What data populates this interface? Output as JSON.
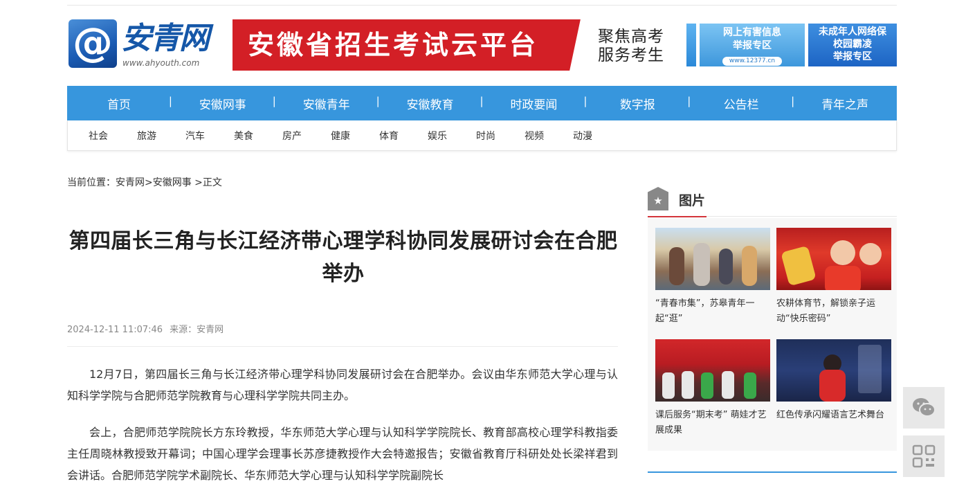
{
  "header": {
    "logo_mark": "@",
    "logo_text": "安青网",
    "logo_url": "www.ahyouth.com",
    "banner_title": "安徽省招生考试云平台",
    "banner_side_line1": "聚焦高考",
    "banner_side_line2": "服务考生",
    "ad_left_line1": "网上有害信息",
    "ad_left_line2": "举报专区",
    "ad_left_url": "www.12377.cn",
    "ad_right_line1": "未成年人网络保",
    "ad_right_line2": "校园霸凌",
    "ad_right_line3": "举报专区"
  },
  "nav": {
    "items": [
      "首页",
      "安徽网事",
      "安徽青年",
      "安徽教育",
      "时政要闻",
      "数字报",
      "公告栏",
      "青年之声"
    ]
  },
  "subnav": {
    "items": [
      "社会",
      "旅游",
      "汽车",
      "美食",
      "房产",
      "健康",
      "体育",
      "娱乐",
      "时尚",
      "视频",
      "动漫"
    ]
  },
  "breadcrumb": {
    "prefix": "当前位置：",
    "home": "安青网",
    "sep1": ">",
    "section": "安徽网事",
    "sep2": " >",
    "current": "正文"
  },
  "article": {
    "title": "第四届长三角与长江经济带心理学科协同发展研讨会在合肥举办",
    "datetime": "2024-12-11 11:07:46",
    "source": "来源：安青网",
    "para1": "12月7日，第四届长三角与长江经济带心理学科协同发展研讨会在合肥举办。会议由华东师范大学心理与认知科学学院与合肥师范学院教育与心理科学学院共同主办。",
    "para2": "会上，合肥师范学院院长方东玲教授，华东师范大学心理与认知科学学院院长、教育部高校心理学科教指委主任周晓林教授致开幕词；中国心理学会理事长苏彦捷教授作大会特邀报告；安徽省教育厅科研处处长梁祥君到会讲话。合肥师范学院学术副院长、华东师范大学心理与认知科学学院副院长"
  },
  "sidebar": {
    "pictures_label": "图片",
    "pictures": [
      {
        "caption": "“青春市集”，苏皋青年一起“逛”"
      },
      {
        "caption": "农耕体育节，解锁亲子运动“快乐密码”"
      },
      {
        "caption": "课后服务“期末考” 萌娃才艺展成果"
      },
      {
        "caption": "红色传承闪耀语言艺术舞台"
      }
    ]
  },
  "colors": {
    "nav_blue": "#3796dd",
    "banner_red": "#d31f26",
    "accent_red": "#d3343a"
  }
}
